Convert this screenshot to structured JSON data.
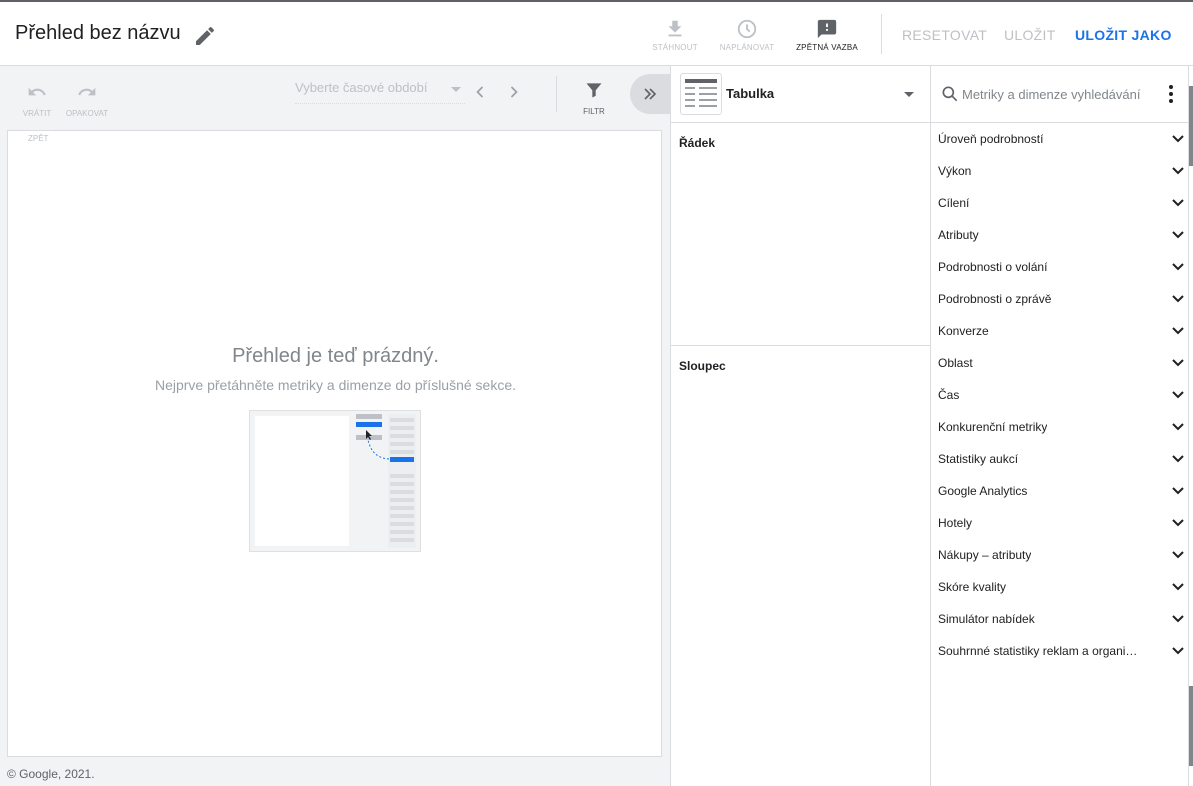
{
  "header": {
    "title": "Přehled bez názvu",
    "actions": [
      {
        "label": "STÁHNOUT",
        "icon": "download-icon"
      },
      {
        "label": "NAPLÁNOVAT",
        "icon": "schedule-icon"
      },
      {
        "label": "ZPĚTNÁ VAZBA",
        "icon": "feedback-icon"
      }
    ],
    "reset_label": "RESETOVAT",
    "save_label": "ULOŽIT",
    "save_as_label": "ULOŽIT JAKO"
  },
  "toolbar": {
    "undo_label": "VRÁTIT",
    "redo_label": "OPAKOVAT",
    "date_placeholder": "Vyberte časové období",
    "filter_label": "FILTR",
    "back_label": "ZPĚT"
  },
  "canvas": {
    "empty_title": "Přehled je teď prázdný.",
    "empty_subtitle": "Nejprve přetáhněte metriky a dimenze do příslušné sekce."
  },
  "footer": {
    "copyright": "© Google, 2021."
  },
  "config": {
    "visualization": "Tabulka",
    "rows_label": "Řádek",
    "columns_label": "Sloupec"
  },
  "metrics": {
    "search_placeholder": "Metriky a dimenze vyhledávání",
    "categories": [
      "Úroveň podrobností",
      "Výkon",
      "Cílení",
      "Atributy",
      "Podrobnosti o volání",
      "Podrobnosti o zprávě",
      "Konverze",
      "Oblast",
      "Čas",
      "Konkurenční metriky",
      "Statistiky aukcí",
      "Google Analytics",
      "Hotely",
      "Nákupy – atributy",
      "Skóre kvality",
      "Simulátor nabídek",
      "Souhrnné statistiky reklam a organi…"
    ]
  },
  "colors": {
    "accent": "#1a73e8",
    "disabled": "#bdc1c6",
    "canvas_bg": "#f1f3f4"
  }
}
